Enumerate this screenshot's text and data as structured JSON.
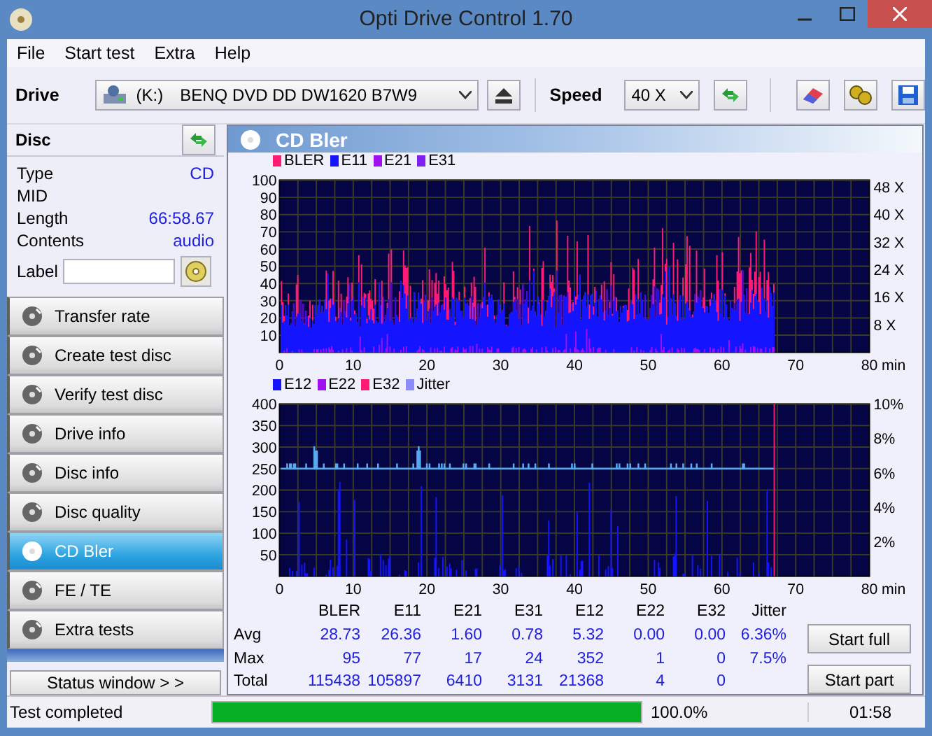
{
  "window": {
    "title": "Opti Drive Control 1.70"
  },
  "menu": [
    "File",
    "Start test",
    "Extra",
    "Help"
  ],
  "toolbar": {
    "drive_label": "Drive",
    "drive_letter": "(K:)",
    "drive": "BENQ DVD DD DW1620 B7W9",
    "speed_label": "Speed",
    "speed": "40 X"
  },
  "disc": {
    "title": "Disc",
    "info": [
      {
        "label": "Type",
        "value": "CD"
      },
      {
        "label": "MID"
      },
      {
        "label": "Length",
        "value": "66:58.67"
      },
      {
        "label": "Contents",
        "value": "audio"
      }
    ],
    "label_field": "Label"
  },
  "nav": [
    {
      "label": "Transfer rate",
      "selected": false
    },
    {
      "label": "Create test disc",
      "selected": false
    },
    {
      "label": "Verify test disc",
      "selected": false
    },
    {
      "label": "Drive info",
      "selected": false
    },
    {
      "label": "Disc info",
      "selected": false
    },
    {
      "label": "Disc quality",
      "selected": false
    },
    {
      "label": "CD Bler",
      "selected": true
    },
    {
      "label": "FE / TE",
      "selected": false
    },
    {
      "label": "Extra tests",
      "selected": false
    }
  ],
  "status_button": "Status window > >",
  "panel": {
    "title": "CD Bler"
  },
  "chart1": {
    "legend": [
      {
        "label": "BLER",
        "color": "#ff1a75"
      },
      {
        "label": "E11",
        "color": "#1414ff"
      },
      {
        "label": "E21",
        "color": "#a010f0"
      },
      {
        "label": "E31",
        "color": "#8020f0"
      }
    ],
    "yticks": [
      "100",
      "90",
      "80",
      "70",
      "60",
      "50",
      "40",
      "30",
      "20",
      "10"
    ],
    "right_ticks": [
      "48 X",
      "40 X",
      "32 X",
      "24 X",
      "16 X",
      "8 X"
    ],
    "xticks": [
      "0",
      "10",
      "20",
      "30",
      "40",
      "50",
      "60",
      "70",
      "80"
    ],
    "x_unit": "min"
  },
  "chart2": {
    "legend": [
      {
        "label": "E12",
        "color": "#1414ff"
      },
      {
        "label": "E22",
        "color": "#a010f0"
      },
      {
        "label": "E32",
        "color": "#ff1a75"
      },
      {
        "label": "Jitter",
        "color": "#8c8cff"
      }
    ],
    "yticks": [
      "400",
      "350",
      "300",
      "250",
      "200",
      "150",
      "100",
      "50"
    ],
    "right_ticks": [
      "10%",
      "8%",
      "6%",
      "4%",
      "2%"
    ],
    "xticks": [
      "0",
      "10",
      "20",
      "30",
      "40",
      "50",
      "60",
      "70",
      "80"
    ],
    "x_unit": "min"
  },
  "stats": {
    "columns": [
      "BLER",
      "E11",
      "E21",
      "E31",
      "E12",
      "E22",
      "E32",
      "Jitter"
    ],
    "rows": [
      {
        "label": "Avg",
        "values": [
          "28.73",
          "26.36",
          "1.60",
          "0.78",
          "5.32",
          "0.00",
          "0.00",
          "6.36%"
        ]
      },
      {
        "label": "Max",
        "values": [
          "95",
          "77",
          "17",
          "24",
          "352",
          "1",
          "0",
          "7.5%"
        ]
      },
      {
        "label": "Total",
        "values": [
          "115438",
          "105897",
          "6410",
          "3131",
          "21368",
          "4",
          "0"
        ]
      }
    ]
  },
  "buttons": [
    "Start full",
    "Start part"
  ],
  "status_bar": {
    "message": "Test completed",
    "level": 1.0,
    "percent": "100.0%",
    "time": "01:58"
  }
}
